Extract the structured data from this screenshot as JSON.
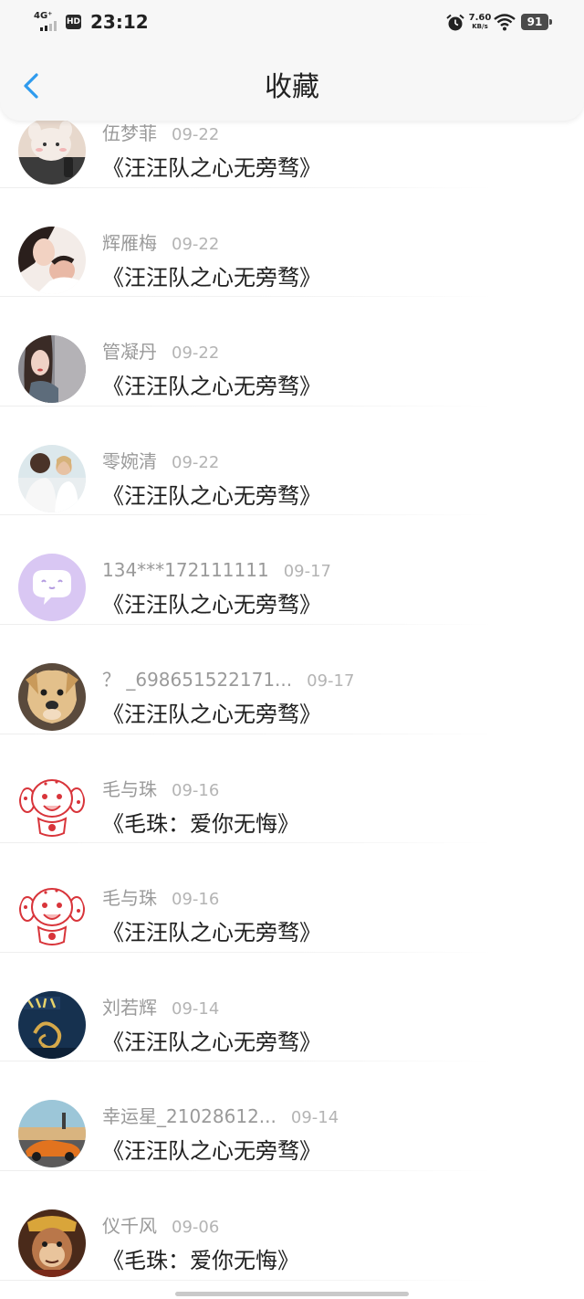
{
  "status_bar": {
    "network": "4G⁺",
    "hd": "HD",
    "time": "23:12",
    "speed_value": "7.60",
    "speed_unit": "KB/s",
    "battery": "91",
    "icons": [
      "signal-icon",
      "alarm-icon",
      "wifi-icon",
      "battery-icon"
    ]
  },
  "header": {
    "title": "收藏",
    "back_icon": "back-chevron-icon",
    "accent_color": "#2f9bee"
  },
  "items": [
    {
      "user": "伍梦菲",
      "date": "09-22",
      "title": "《汪汪队之心无旁骛》",
      "avatar": "plush-toy-photo"
    },
    {
      "user": "辉雁梅",
      "date": "09-22",
      "title": "《汪汪队之心无旁骛》",
      "avatar": "woman-with-child-photo"
    },
    {
      "user": "管凝丹",
      "date": "09-22",
      "title": "《汪汪队之心无旁骛》",
      "avatar": "woman-portrait-photo"
    },
    {
      "user": "零婉清",
      "date": "09-22",
      "title": "《汪汪队之心无旁骛》",
      "avatar": "couple-photo"
    },
    {
      "user": "134***172111111",
      "date": "09-17",
      "title": "《汪汪队之心无旁骛》",
      "avatar": "default-chat-icon"
    },
    {
      "user": "？ _698651522171...",
      "date": "09-17",
      "title": "《汪汪队之心无旁骛》",
      "avatar": "dog-photo"
    },
    {
      "user": "毛与珠",
      "date": "09-16",
      "title": "《毛珠：爱你无悔》",
      "avatar": "dalmatian-cartoon"
    },
    {
      "user": "毛与珠",
      "date": "09-16",
      "title": "《汪汪队之心无旁骛》",
      "avatar": "dalmatian-cartoon"
    },
    {
      "user": "刘若辉",
      "date": "09-14",
      "title": "《汪汪队之心无旁骛》",
      "avatar": "dragon-poster"
    },
    {
      "user": "幸运星_21028612...",
      "date": "09-14",
      "title": "《汪汪队之心无旁骛》",
      "avatar": "sports-car-photo"
    },
    {
      "user": "仪千风",
      "date": "09-06",
      "title": "《毛珠：爱你无悔》",
      "avatar": "monkey-king-photo"
    }
  ]
}
